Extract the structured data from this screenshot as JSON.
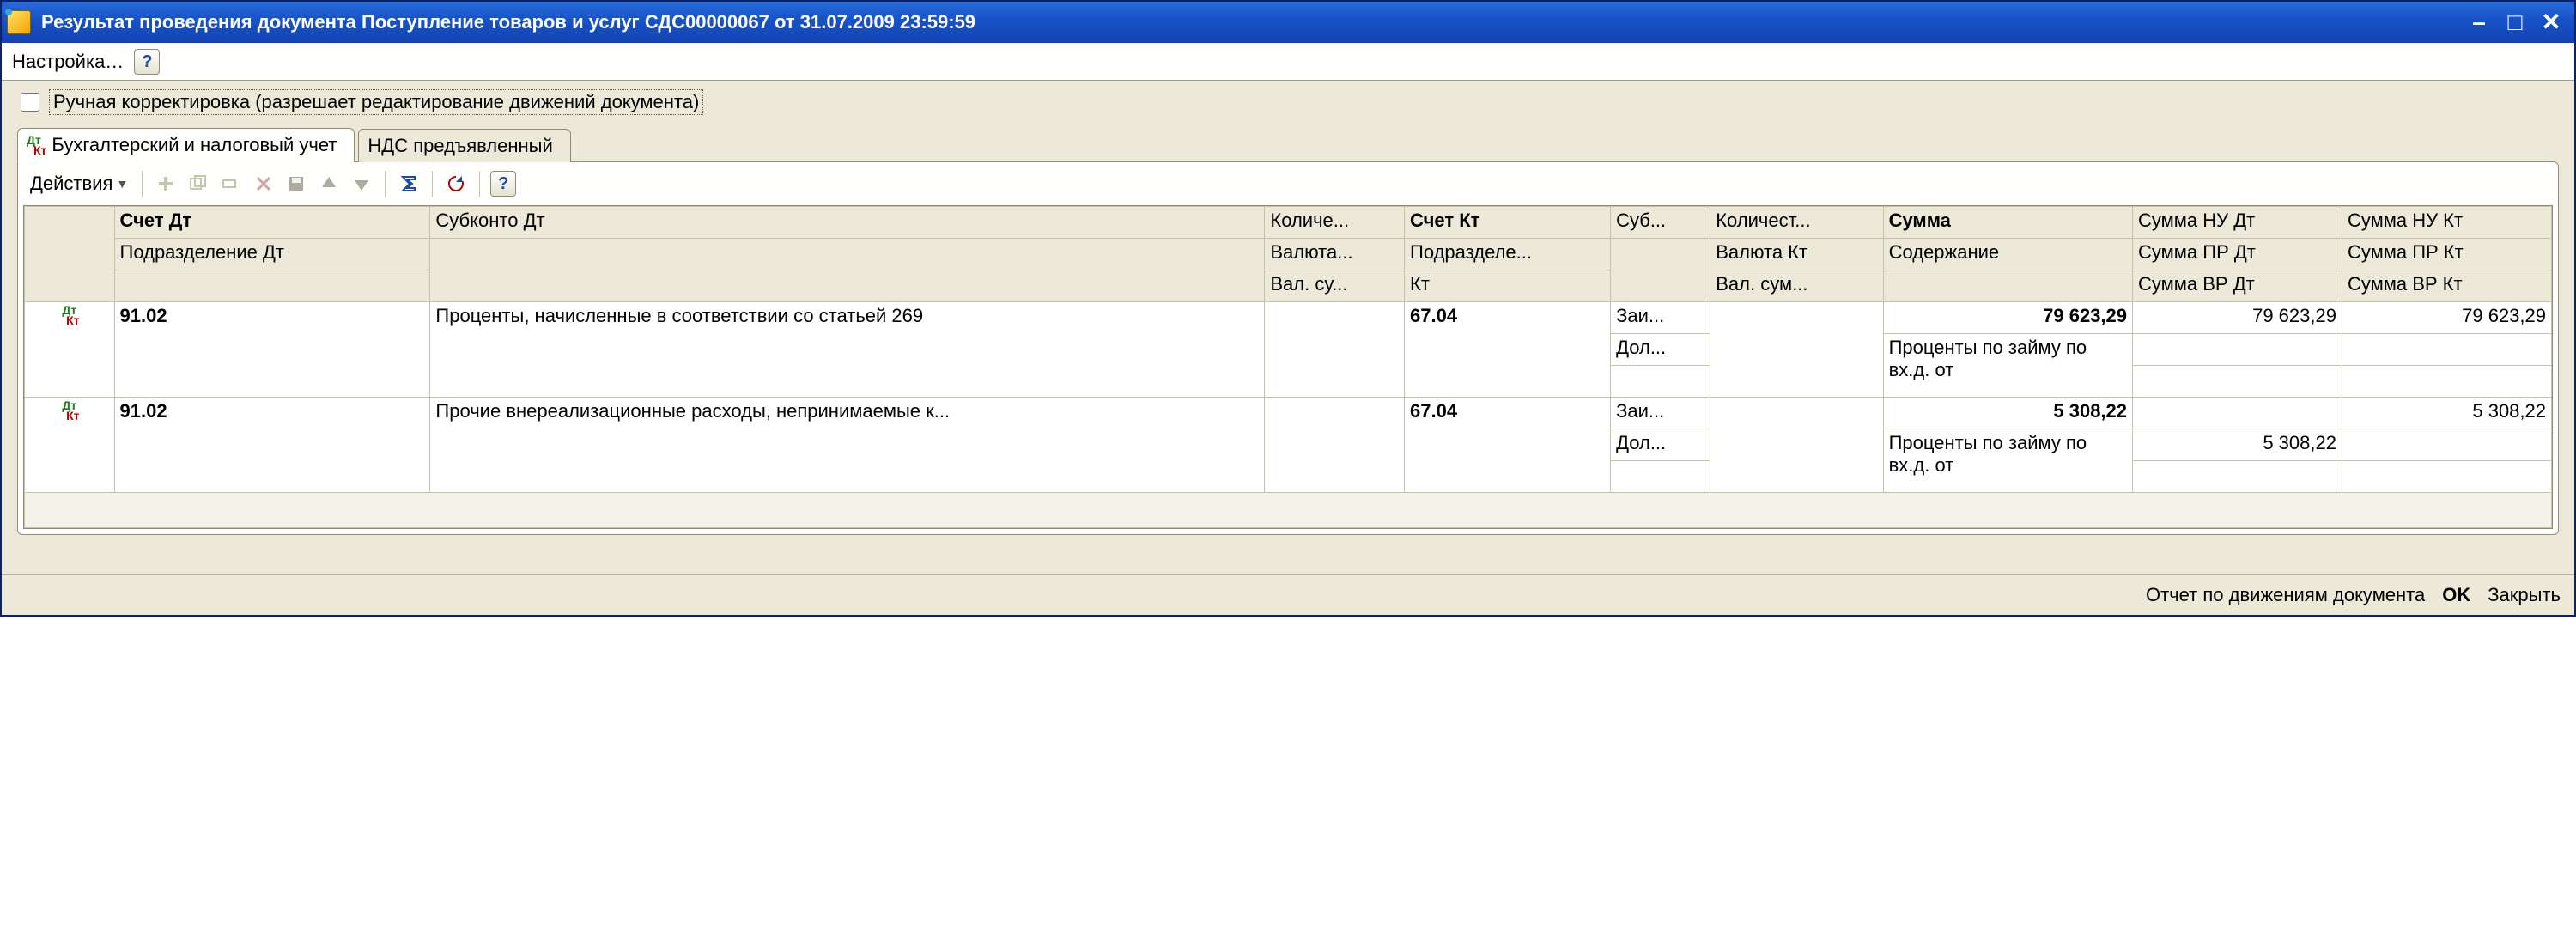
{
  "window": {
    "title": "Результат проведения документа Поступление товаров и услуг СДС00000067 от 31.07.2009 23:59:59",
    "min_tip": "Свернуть",
    "max_tip": "Развернуть",
    "close_tip": "Закрыть"
  },
  "menubar": {
    "settings": "Настройка…",
    "help_symbol": "?"
  },
  "checkbox": {
    "label": "Ручная корректировка (разрешает редактирование движений документа)"
  },
  "tabs": {
    "tab1": "Бухгалтерский и налоговый учет",
    "tab2": "НДС предъявленный"
  },
  "toolbar": {
    "actions": "Действия"
  },
  "headers": {
    "r1": {
      "schet_dt": "Счет Дт",
      "subkonto_dt": "Субконто Дт",
      "kolich": "Количе...",
      "schet_kt": "Счет Кт",
      "sub": "Суб...",
      "kolich2": "Количест...",
      "summa": "Сумма",
      "nu_dt": "Сумма НУ Дт",
      "nu_kt": "Сумма НУ Кт"
    },
    "r2": {
      "podr_dt": "Подразделение Дт",
      "valuta": "Валюта...",
      "podr_kt": "Подразделе...",
      "valuta_kt": "Валюта Кт",
      "soderzh": "Содержание",
      "pr_dt": "Сумма ПР Дт",
      "pr_kt": "Сумма ПР Кт"
    },
    "r3": {
      "val_su": "Вал. су...",
      "kt": "Кт",
      "val_sum": "Вал. сум...",
      "vr_dt": "Сумма ВР Дт",
      "vr_kt": "Сумма ВР Кт"
    }
  },
  "rows": [
    {
      "schet_dt": "91.02",
      "subkonto": "Проценты, начисленные в соответствии со статьей 269",
      "schet_kt": "67.04",
      "subkt1": "Заи...",
      "subkt2": "Дол...",
      "summa": "79 623,29",
      "soderzh": "Проценты по займу по вх.д. от",
      "nu_dt": "79 623,29",
      "nu_kt": "79 623,29",
      "pr_dt": "",
      "pr_kt": ""
    },
    {
      "schet_dt": "91.02",
      "subkonto": "Прочие внереализационные расходы, непринимаемые к...",
      "schet_kt": "67.04",
      "subkt1": "Заи...",
      "subkt2": "Дол...",
      "summa": "5 308,22",
      "soderzh": "Проценты по займу по вх.д. от",
      "nu_dt": "",
      "nu_kt": "5 308,22",
      "pr_dt": "5 308,22",
      "pr_kt": ""
    }
  ],
  "footer": {
    "report": "Отчет по движениям документа",
    "ok": "OK",
    "close": "Закрыть"
  }
}
